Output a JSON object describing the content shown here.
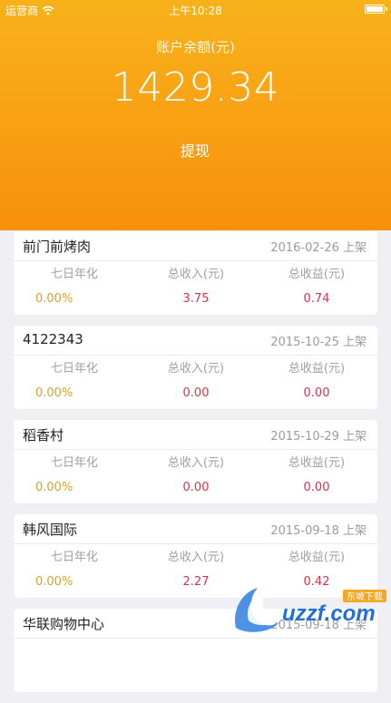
{
  "status_bar": {
    "carrier": "运营商",
    "time": "上午10:28"
  },
  "account": {
    "balance_label": "账户余额(元)",
    "balance": "1429.34",
    "withdraw_label": "提现"
  },
  "stat_labels": {
    "annual": "七日年化",
    "total_income": "总收入(元)",
    "total_profit": "总收益(元)"
  },
  "stores": [
    {
      "name": "前门前烤肉",
      "date": "2016-02-26 上架",
      "annual": "0.00%",
      "income": "3.75",
      "profit": "0.74"
    },
    {
      "name": "4122343",
      "date": "2015-10-25 上架",
      "annual": "0.00%",
      "income": "0.00",
      "profit": "0.00"
    },
    {
      "name": "稻香村",
      "date": "2015-10-29 上架",
      "annual": "0.00%",
      "income": "0.00",
      "profit": "0.00"
    },
    {
      "name": "韩风国际",
      "date": "2015-09-18 上架",
      "annual": "0.00%",
      "income": "2.27",
      "profit": "0.42"
    },
    {
      "name": "华联购物中心",
      "date": "2015-09-18 上架",
      "annual": "",
      "income": "",
      "profit": ""
    }
  ],
  "watermark": {
    "site": "uzzf.com",
    "caption": "东坡下载"
  },
  "colors": {
    "header_top": "#f7b21a",
    "header_bottom": "#f8900c",
    "annual_value": "#d7a324",
    "money_value": "#d0354a"
  }
}
